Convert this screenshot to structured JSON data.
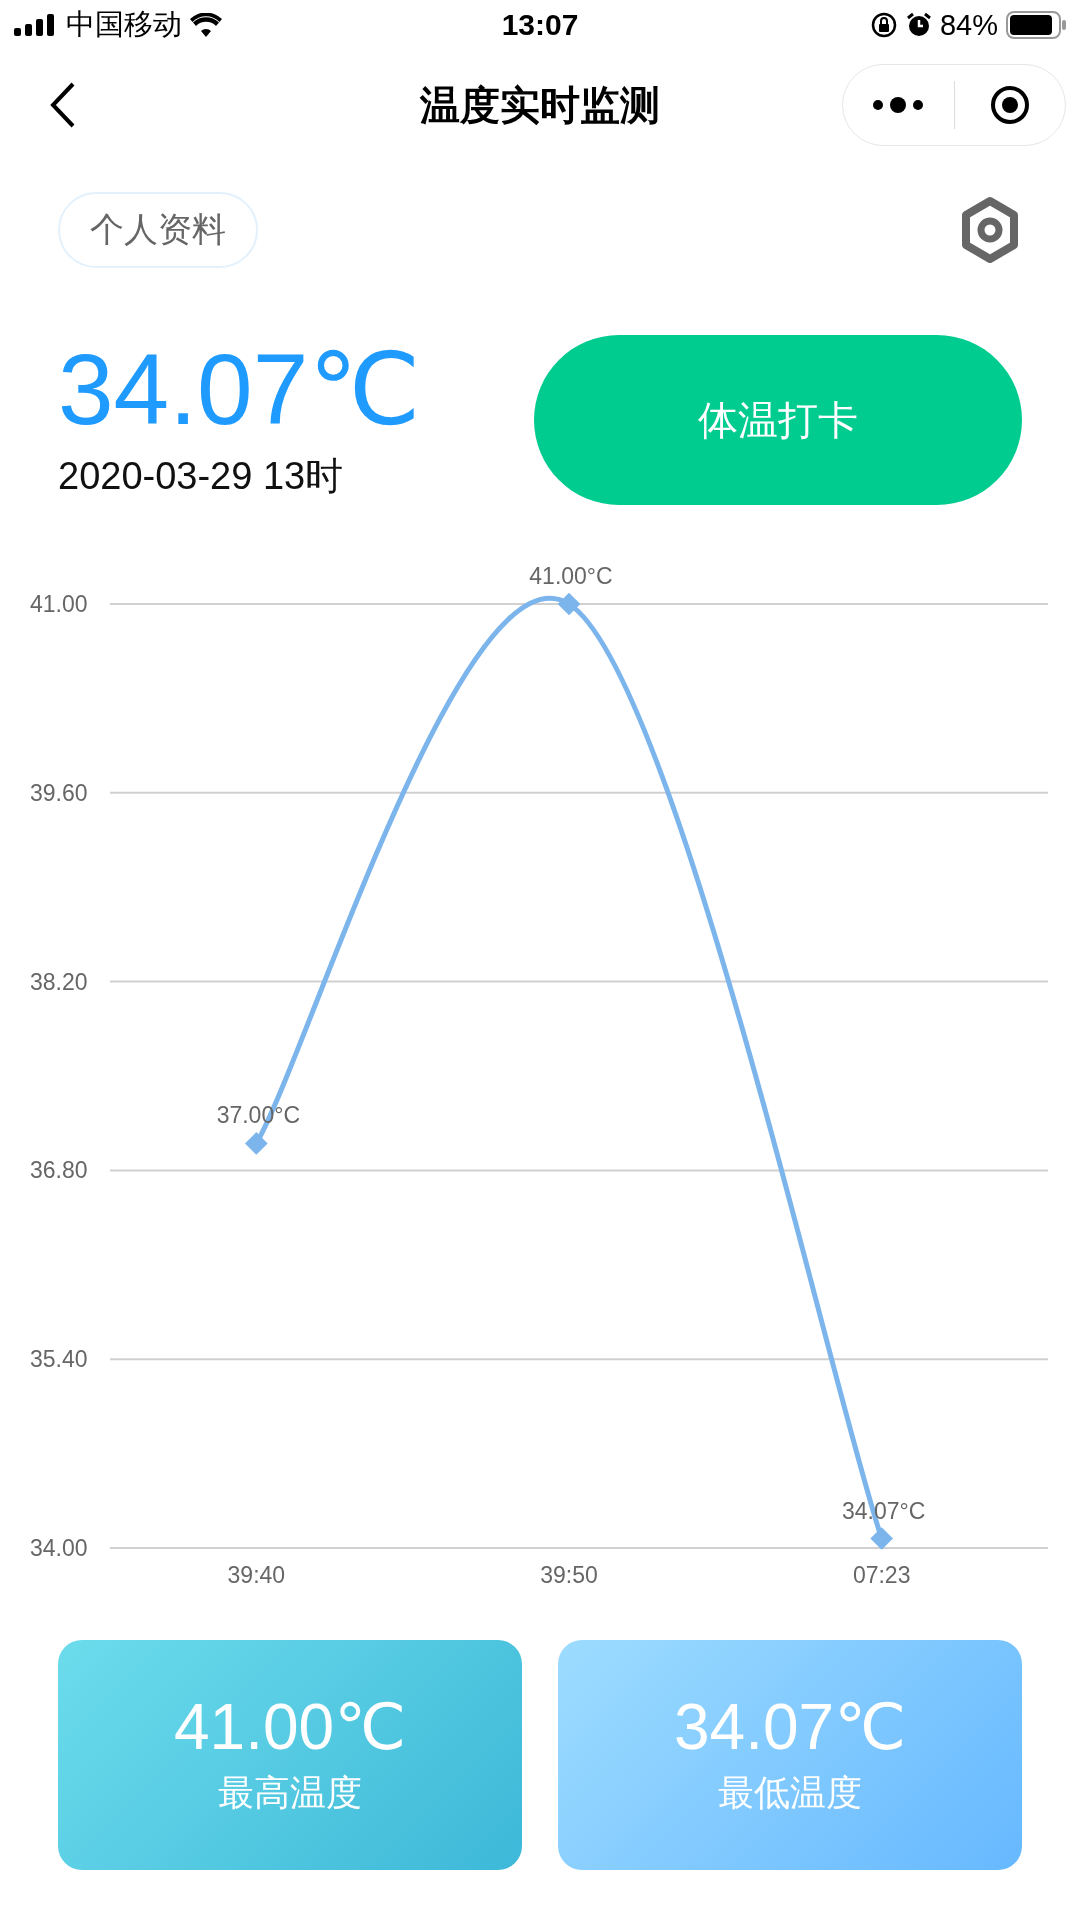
{
  "status_bar": {
    "carrier": "中国移动",
    "time": "13:07",
    "battery": "84%"
  },
  "nav": {
    "title": "温度实时监测"
  },
  "profile_button": "个人资料",
  "current": {
    "temperature": "34.07℃",
    "time": "2020-03-29 13时"
  },
  "checkin_button": "体温打卡",
  "chart": {
    "chart_data": {
      "type": "line",
      "categories": [
        "39:40",
        "39:50",
        "07:23"
      ],
      "series": [
        {
          "color": "#7cb5ec",
          "marker": "diamond",
          "values": [
            37,
            41,
            34.07
          ]
        }
      ],
      "grid": true,
      "ylim": [
        34,
        41
      ],
      "yticks": [
        {
          "value": 34,
          "label": "34.00"
        },
        {
          "value": 35.4,
          "label": "35.40"
        },
        {
          "value": 36.8,
          "label": "36.80"
        },
        {
          "value": 38.2,
          "label": "38.20"
        },
        {
          "value": 39.6,
          "label": "39.60"
        },
        {
          "value": 41,
          "label": "41.00"
        }
      ],
      "value_labels": [
        "37.00°C",
        "41.00°C",
        "34.07°C"
      ]
    }
  },
  "stats": [
    {
      "kind": "max",
      "value": "41.00℃",
      "label": "最高温度"
    },
    {
      "kind": "min",
      "value": "34.07℃",
      "label": "最低温度"
    }
  ]
}
